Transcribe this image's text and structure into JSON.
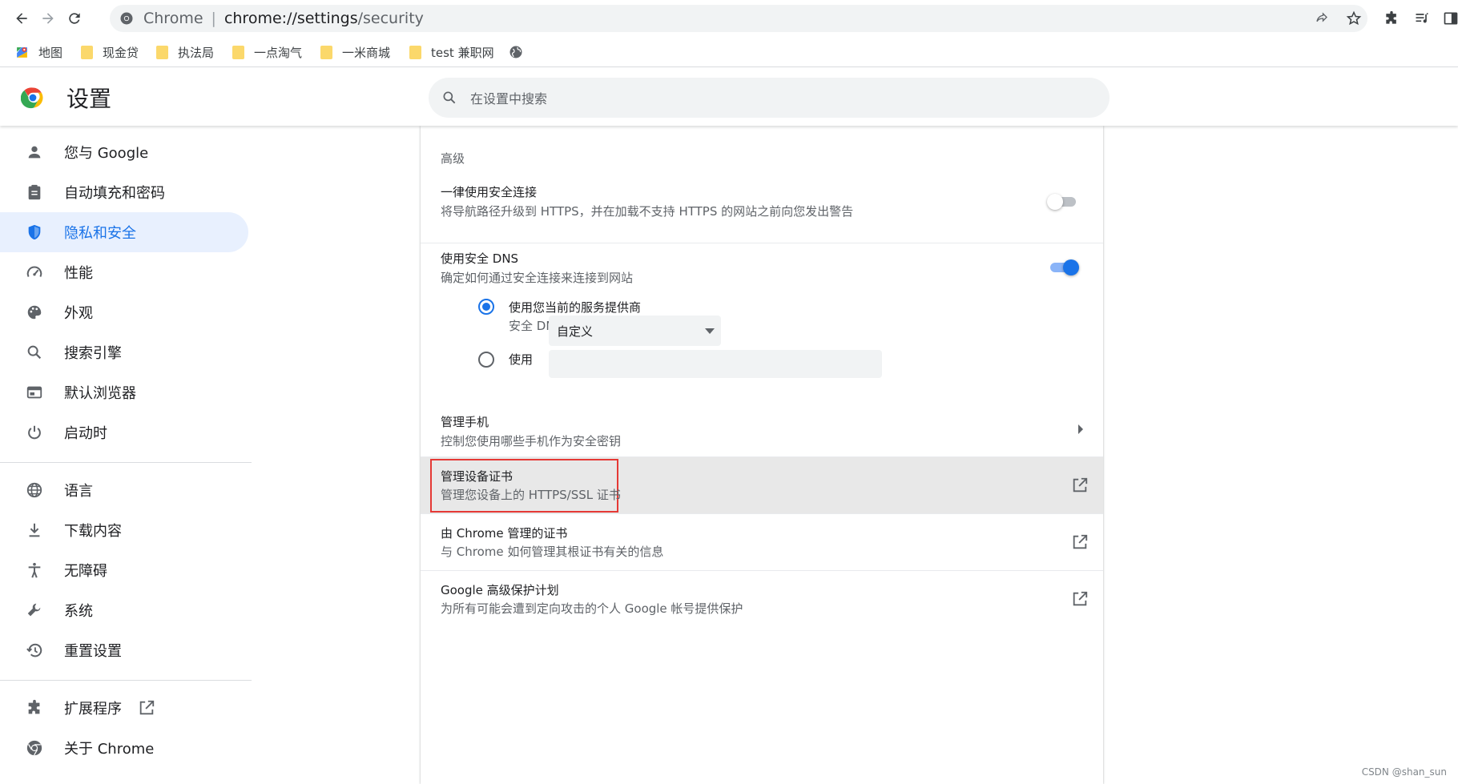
{
  "browser": {
    "omnibox_label": "Chrome",
    "omnibox_separator": "|",
    "url_host": "chrome://settings",
    "url_path": "/security",
    "icons": [
      "back-icon",
      "forward-icon",
      "reload-icon",
      "site-info-icon",
      "share-icon",
      "bookmark-star-icon",
      "extensions-icon",
      "reading-list-icon",
      "side-panel-icon"
    ]
  },
  "bookmarks": [
    {
      "label": "地图",
      "icon": "maps-icon"
    },
    {
      "label": "现金贷",
      "icon": "folder-icon"
    },
    {
      "label": "执法局",
      "icon": "folder-icon"
    },
    {
      "label": "一点淘气",
      "icon": "folder-icon"
    },
    {
      "label": "一米商城",
      "icon": "folder-icon"
    },
    {
      "label": "test 兼职网",
      "icon": "folder-icon"
    },
    {
      "label": "",
      "icon": "globe-icon"
    }
  ],
  "header": {
    "title": "设置",
    "search_placeholder": "在设置中搜索"
  },
  "sidebar": {
    "items": [
      {
        "label": "您与 Google",
        "icon": "person-icon"
      },
      {
        "label": "自动填充和密码",
        "icon": "clipboard-icon"
      },
      {
        "label": "隐私和安全",
        "icon": "shield-icon",
        "active": true
      },
      {
        "label": "性能",
        "icon": "speedometer-icon"
      },
      {
        "label": "外观",
        "icon": "palette-icon"
      },
      {
        "label": "搜索引擎",
        "icon": "search-icon"
      },
      {
        "label": "默认浏览器",
        "icon": "browser-icon"
      },
      {
        "label": "启动时",
        "icon": "power-icon"
      },
      {
        "label": "语言",
        "icon": "globe-icon"
      },
      {
        "label": "下载内容",
        "icon": "download-icon"
      },
      {
        "label": "无障碍",
        "icon": "accessibility-icon"
      },
      {
        "label": "系统",
        "icon": "wrench-icon"
      },
      {
        "label": "重置设置",
        "icon": "history-icon"
      },
      {
        "label": "扩展程序",
        "icon": "puzzle-icon"
      },
      {
        "label": "关于 Chrome",
        "icon": "chrome-icon"
      }
    ]
  },
  "main": {
    "section_title": "高级",
    "https_only": {
      "title": "一律使用安全连接",
      "subtitle": "将导航路径升级到 HTTPS，并在加载不支持 HTTPS 的网站之前向您发出警告",
      "enabled": false
    },
    "secure_dns": {
      "title": "使用安全 DNS",
      "subtitle": "确定如何通过安全连接来连接到网站",
      "enabled": true,
      "option_current_title": "使用您当前的服务提供商",
      "option_current_sub": "安全 DNS 未必一直可用",
      "option_custom_label": "使用",
      "custom_select_value": "自定义",
      "custom_input_value": ""
    },
    "manage_phones": {
      "title": "管理手机",
      "subtitle": "控制您使用哪些手机作为安全密钥"
    },
    "manage_certs": {
      "title": "管理设备证书",
      "subtitle": "管理您设备上的 HTTPS/SSL 证书"
    },
    "chrome_certs": {
      "title": "由 Chrome 管理的证书",
      "subtitle": "与 Chrome 如何管理其根证书有关的信息"
    },
    "advanced_protection": {
      "title": "Google 高级保护计划",
      "subtitle": "为所有可能会遭到定向攻击的个人 Google 帐号提供保护"
    }
  },
  "colors": {
    "accent": "#1a73e8",
    "active_bg": "#e8f0fe",
    "highlight_box": "#e53935"
  },
  "watermark": "CSDN @shan_sun"
}
